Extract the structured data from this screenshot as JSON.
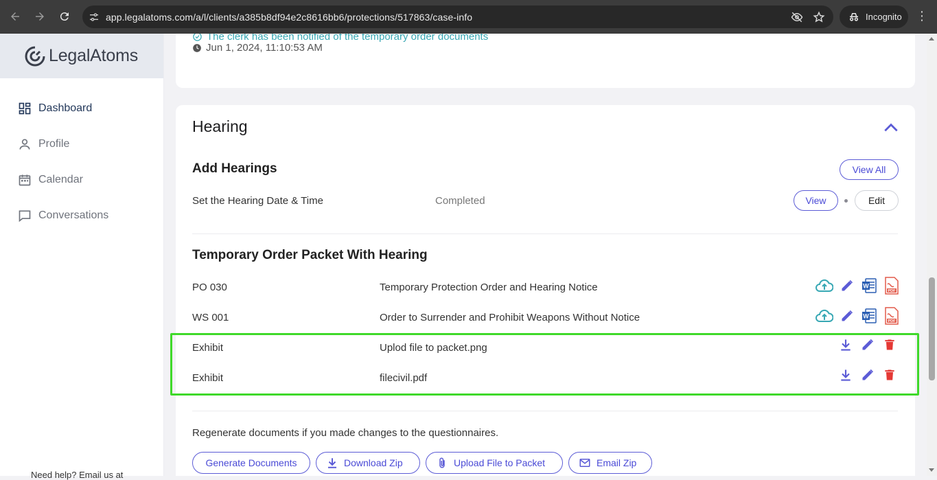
{
  "browser": {
    "url": "app.legalatoms.com/a/l/clients/a385b8df94e2c8616bb6/protections/517863/case-info",
    "incognito_label": "Incognito"
  },
  "sidebar": {
    "brand_left": "Legal",
    "brand_right": "Atoms",
    "items": [
      {
        "label": "Dashboard",
        "icon": "dashboard-icon"
      },
      {
        "label": "Profile",
        "icon": "person-icon"
      },
      {
        "label": "Calendar",
        "icon": "calendar-icon"
      },
      {
        "label": "Conversations",
        "icon": "chat-icon"
      }
    ],
    "help_text": "Need help? Email us at"
  },
  "status": {
    "notified": "The clerk has been notified of the temporary order documents",
    "timestamp": "Jun 1, 2024, 11:10:53 AM"
  },
  "hearing": {
    "title": "Hearing",
    "add_hearings": {
      "title": "Add Hearings",
      "view_all": "View All",
      "task": "Set the Hearing Date & Time",
      "status": "Completed",
      "view": "View",
      "edit": "Edit"
    },
    "packet": {
      "title": "Temporary Order Packet With Hearing",
      "forms": [
        {
          "code": "PO 030",
          "name": "Temporary Protection Order and Hearing Notice"
        },
        {
          "code": "WS 001",
          "name": "Order to Surrender and Prohibit Weapons Without Notice"
        }
      ],
      "exhibits": [
        {
          "type": "Exhibit",
          "file": "Uplod file to packet.png"
        },
        {
          "type": "Exhibit",
          "file": "filecivil.pdf"
        }
      ]
    },
    "regen_text": "Regenerate documents if you made changes to the questionnaires.",
    "actions": {
      "generate": "Generate Documents",
      "download_zip": "Download Zip",
      "upload": "Upload File to Packet",
      "email_zip": "Email Zip"
    }
  },
  "colors": {
    "accent": "#5b5bd6",
    "teal": "#38a8b4",
    "delete": "#e53935",
    "highlight": "#3fd92a"
  }
}
